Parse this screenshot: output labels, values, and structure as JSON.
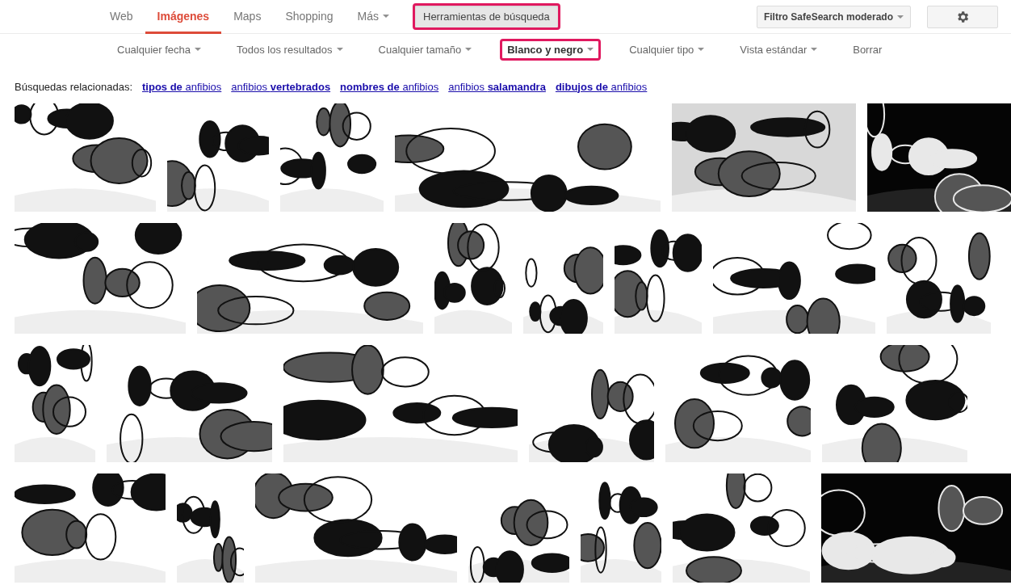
{
  "nav_tabs": [
    {
      "label": "Web",
      "selected": false,
      "dropdown": false
    },
    {
      "label": "Imágenes",
      "selected": true,
      "dropdown": false
    },
    {
      "label": "Maps",
      "selected": false,
      "dropdown": false
    },
    {
      "label": "Shopping",
      "selected": false,
      "dropdown": false
    },
    {
      "label": "Más",
      "selected": false,
      "dropdown": true
    }
  ],
  "tools_button": {
    "label": "Herramientas de búsqueda",
    "pressed": true,
    "highlighted": true
  },
  "safesearch_button": {
    "label": "Filtro SafeSearch moderado"
  },
  "tool_filters": [
    {
      "label": "Cualquier fecha",
      "selected": false,
      "highlighted": false,
      "dropdown": true
    },
    {
      "label": "Todos los resultados",
      "selected": false,
      "highlighted": false,
      "dropdown": true
    },
    {
      "label": "Cualquier tamaño",
      "selected": false,
      "highlighted": false,
      "dropdown": true
    },
    {
      "label": "Blanco y negro",
      "selected": true,
      "highlighted": true,
      "dropdown": true
    },
    {
      "label": "Cualquier tipo",
      "selected": false,
      "highlighted": false,
      "dropdown": true
    },
    {
      "label": "Vista estándar",
      "selected": false,
      "highlighted": false,
      "dropdown": true
    },
    {
      "label": "Borrar",
      "selected": false,
      "highlighted": false,
      "dropdown": false
    }
  ],
  "related_searches": {
    "label": "Búsquedas relacionadas:",
    "links": [
      "**tipos de** anfibios",
      "anfibios **vertebrados**",
      "**nombres de** anfibios",
      "anfibios **salamandra**",
      "**dibujos de** anfibios"
    ]
  }
}
